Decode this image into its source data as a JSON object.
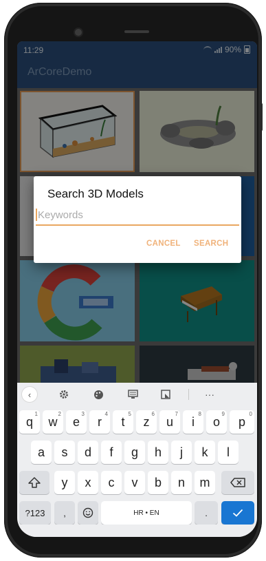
{
  "status_bar": {
    "time": "11:29",
    "battery": "90%"
  },
  "app_bar": {
    "title": "ArCoreDemo"
  },
  "dialog": {
    "title": "Search 3D Models",
    "input_placeholder": "Keywords",
    "input_value": "",
    "cancel_label": "CANCEL",
    "search_label": "SEARCH"
  },
  "keyboard": {
    "toolbar": [
      "chevron-left-icon",
      "gear-icon",
      "palette-icon",
      "clipboard-icon",
      "resize-icon",
      "more-icon"
    ],
    "more_label": "···",
    "row1": [
      {
        "key": "q",
        "hint": "1"
      },
      {
        "key": "w",
        "hint": "2"
      },
      {
        "key": "e",
        "hint": "3"
      },
      {
        "key": "r",
        "hint": "4"
      },
      {
        "key": "t",
        "hint": "5"
      },
      {
        "key": "z",
        "hint": "6"
      },
      {
        "key": "u",
        "hint": "7"
      },
      {
        "key": "i",
        "hint": "8"
      },
      {
        "key": "o",
        "hint": "9"
      },
      {
        "key": "p",
        "hint": "0"
      }
    ],
    "row2": [
      "a",
      "s",
      "d",
      "f",
      "g",
      "h",
      "j",
      "k",
      "l"
    ],
    "row3": [
      "y",
      "x",
      "c",
      "v",
      "b",
      "n",
      "m"
    ],
    "symbols_label": "?123",
    "comma_label": ",",
    "space_label": "HR • EN",
    "period_label": "."
  },
  "colors": {
    "app_bar": "#2a4e7a",
    "accent": "#e9a760",
    "button_text": "#f0b27a",
    "enter_key": "#1976d2"
  }
}
